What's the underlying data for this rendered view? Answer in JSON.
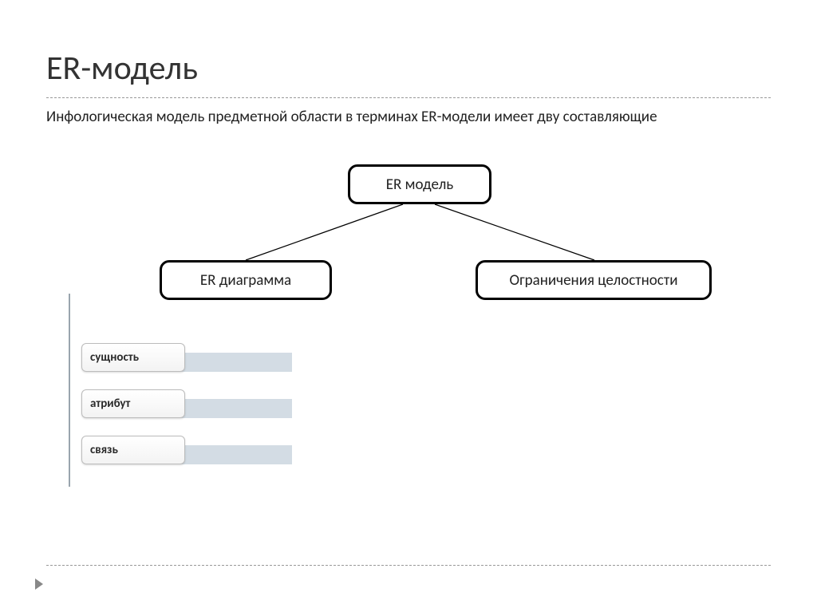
{
  "title": "ER-модель",
  "subtitle": "Инфологическая модель предметной области в терминах ER-модели имеет дву составляющие",
  "nodes": {
    "root": "ER модель",
    "left": "ER диаграмма",
    "right": "Ограничения целостности"
  },
  "list_items": [
    "сущность",
    "атрибут",
    "связь"
  ]
}
